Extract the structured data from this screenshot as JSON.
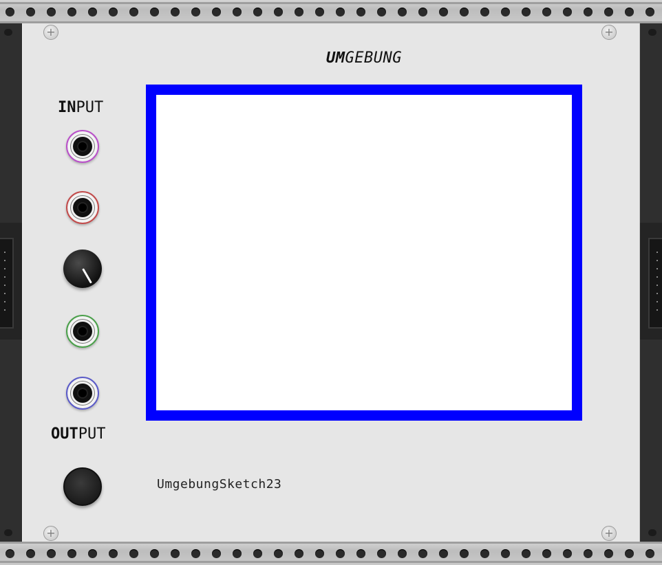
{
  "module": {
    "title_bold": "UM",
    "title_rest": "GEBUNG",
    "input_label_bold": "IN",
    "input_label_rest": "PUT",
    "output_label_bold": "OUT",
    "output_label_rest": "PUT",
    "sketch_name": "UmgebungSketch23",
    "display_border_color": "#0000ff",
    "display_fill_color": "#ffffff",
    "jack_ring_colors": [
      "#b94fc9",
      "#c24a4a",
      "#4aa04a",
      "#5a5ac8"
    ],
    "knob_icon": "knob-icon",
    "screw_icon": "plus-screw-icon"
  }
}
